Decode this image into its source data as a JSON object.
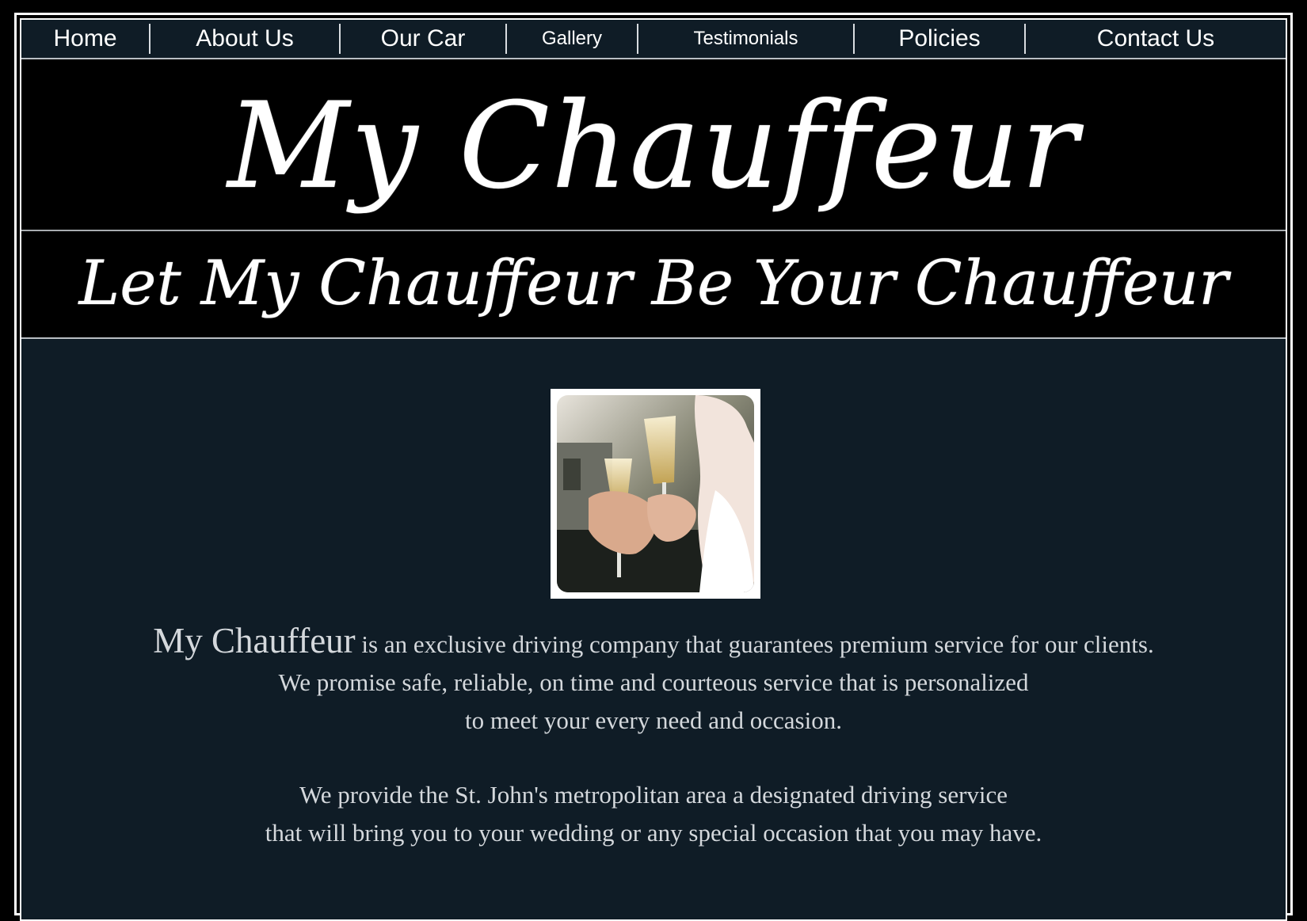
{
  "nav": {
    "items": [
      {
        "label": "Home"
      },
      {
        "label": "About Us"
      },
      {
        "label": "Our Car"
      },
      {
        "label": "Gallery"
      },
      {
        "label": "Testimonials"
      },
      {
        "label": "Policies"
      },
      {
        "label": "Contact Us"
      }
    ]
  },
  "header": {
    "logo_title": "My Chauffeur",
    "tagline": "Let My Chauffeur Be Your Chauffeur"
  },
  "main": {
    "intro_brand": "My Chauffeur",
    "intro_line1": " is an exclusive driving company that guarantees premium service for our clients.",
    "intro_line2": "We promise safe, reliable, on time and courteous service that is personalized",
    "intro_line3": "to meet your every need and occasion.",
    "para2_line1": "We provide the St. John's metropolitan area a designated driving service",
    "para2_line2": "that will bring you to your wedding or any special occasion that you may have."
  },
  "colors": {
    "background": "#0f1c26",
    "header_bg": "#000000",
    "text": "#d4d8dc"
  }
}
